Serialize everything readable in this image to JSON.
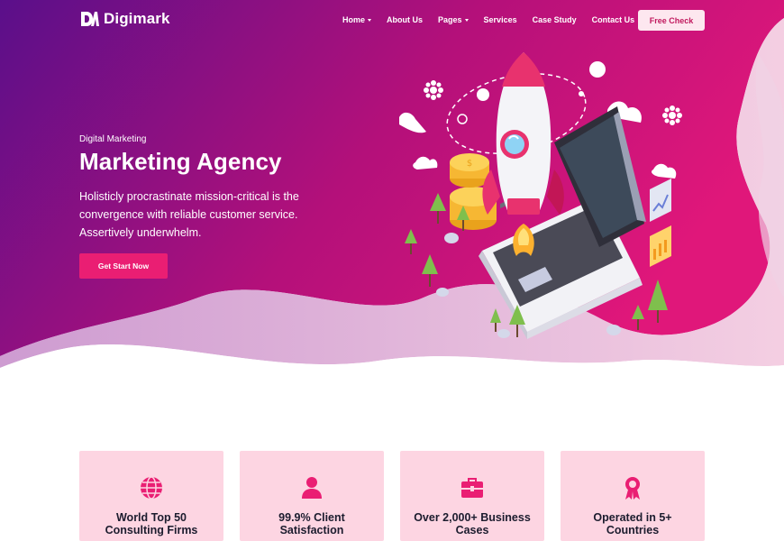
{
  "brand": {
    "name": "Digimark"
  },
  "nav": {
    "items": [
      {
        "label": "Home",
        "has_dropdown": true
      },
      {
        "label": "About Us",
        "has_dropdown": false
      },
      {
        "label": "Pages",
        "has_dropdown": true
      },
      {
        "label": "Services",
        "has_dropdown": false
      },
      {
        "label": "Case Study",
        "has_dropdown": false
      },
      {
        "label": "Contact Us",
        "has_dropdown": false
      }
    ],
    "cta_label": "Free Check"
  },
  "hero": {
    "eyebrow": "Digital Marketing",
    "title": "Marketing Agency",
    "description": "Holisticly procrastinate mission-critical is the convergence with reliable customer service. Assertively underwhelm.",
    "button_label": "Get Start Now"
  },
  "features": [
    {
      "icon": "globe-icon",
      "label": "World Top 50 Consulting Firms"
    },
    {
      "icon": "user-icon",
      "label": "99.9% Client Satisfaction"
    },
    {
      "icon": "briefcase-icon",
      "label": "Over 2,000+ Business Cases"
    },
    {
      "icon": "award-icon",
      "label": "Operated in 5+ Countries"
    }
  ],
  "colors": {
    "hero_gradient_start": "#5a0f8a",
    "hero_gradient_end": "#e0177a",
    "accent": "#ea1e73",
    "card_background": "#fdd5e2"
  }
}
